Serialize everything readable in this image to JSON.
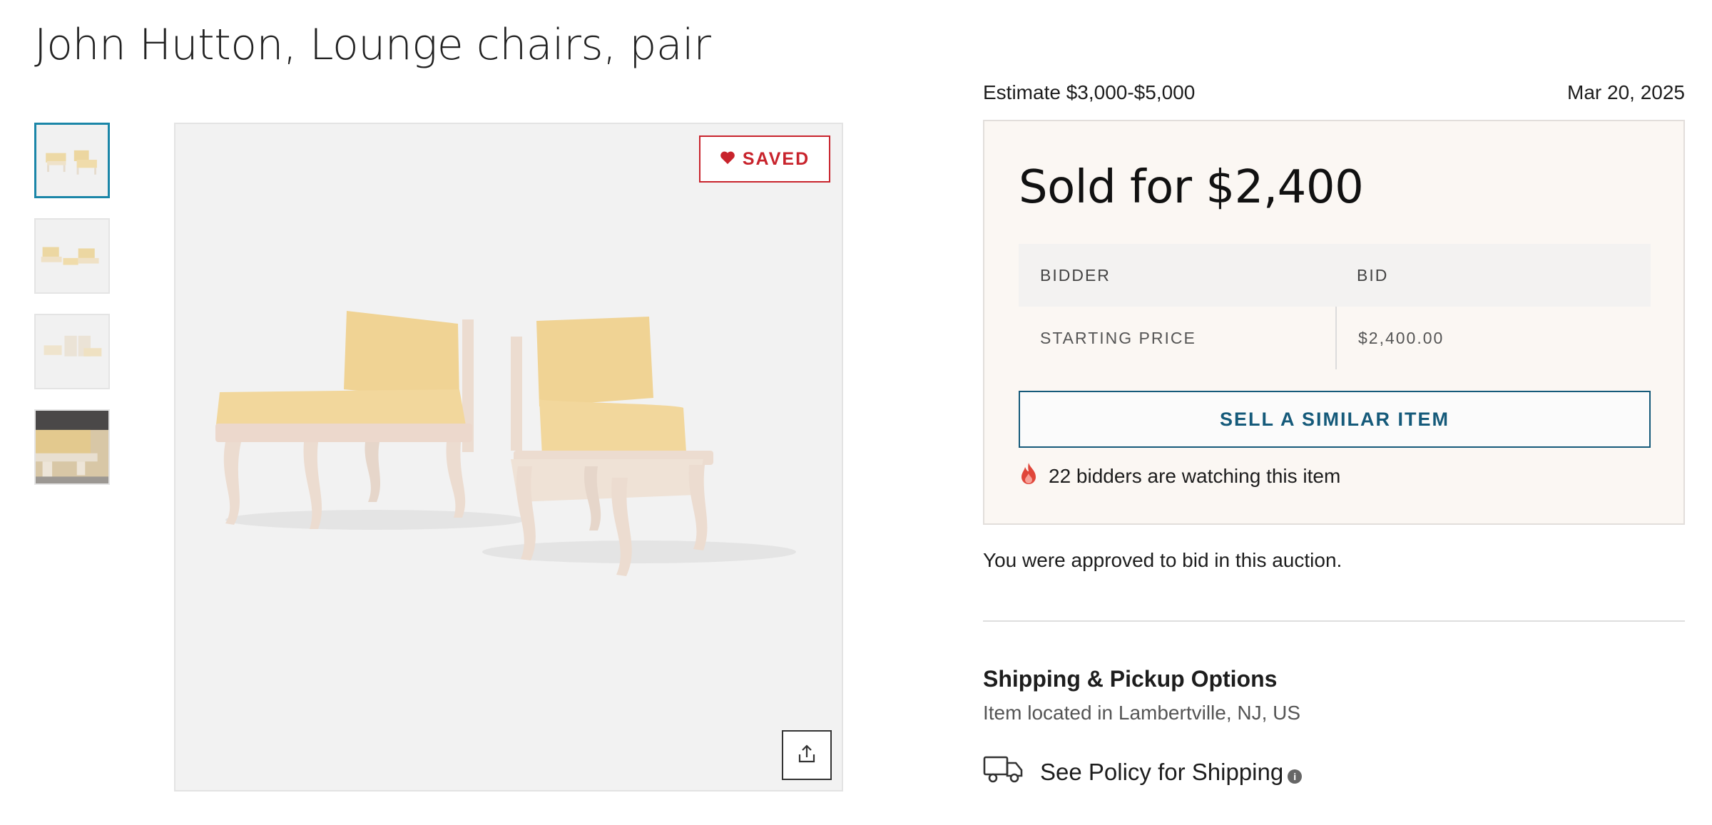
{
  "listing": {
    "title": "John Hutton, Lounge chairs, pair",
    "estimate": "Estimate $3,000-$5,000",
    "date": "Mar 20, 2025"
  },
  "gallery": {
    "thumbnail_count": 4,
    "active_thumbnail": 1,
    "saved_label": "SAVED",
    "icons": {
      "saved": "heart-icon",
      "share": "share-icon"
    }
  },
  "result": {
    "sold_label": "Sold for $2,400",
    "table": {
      "headers": [
        "BIDDER",
        "BID"
      ],
      "rows": [
        [
          "STARTING PRICE",
          "$2,400.00"
        ]
      ]
    },
    "sell_button": "SELL A SIMILAR ITEM",
    "watching_text": "22 bidders are watching this item",
    "watching_icon": "flame-icon"
  },
  "approval_text": "You were approved to bid in this auction.",
  "shipping": {
    "title": "Shipping & Pickup Options",
    "location": "Item located in Lambertville, NJ, US",
    "policy_link": "See Policy for Shipping",
    "icons": {
      "truck": "truck-icon",
      "info": "info-icon"
    }
  },
  "colors": {
    "accent_blue": "#155a7a",
    "saved_red": "#c8232c",
    "active_thumb_border": "#1b86a8",
    "sold_box_bg": "#fbf7f3"
  }
}
